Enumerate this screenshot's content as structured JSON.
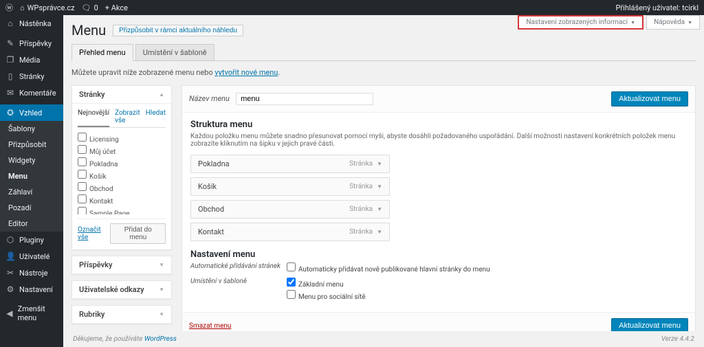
{
  "adminbar": {
    "site_name": "WPsprávce.cz",
    "comments": "0",
    "new": "+ Akce",
    "greeting": "Přihlášený uživatel: tcirkl"
  },
  "topactions": {
    "screen_options": "Nastavení zobrazených informací",
    "help": "Nápověda"
  },
  "sidemenu": {
    "dashboard": "Nástěnka",
    "posts": "Příspěvky",
    "media": "Média",
    "pages": "Stránky",
    "comments": "Komentáře",
    "appearance": "Vzhled",
    "appearance_sub": [
      "Šablony",
      "Přizpůsobit",
      "Widgety",
      "Menu",
      "Záhlaví",
      "Pozadí",
      "Editor"
    ],
    "plugins": "Pluginy",
    "users": "Uživatelé",
    "tools": "Nástroje",
    "settings": "Nastavení",
    "collapse": "Zmenšit menu"
  },
  "page": {
    "title": "Menu",
    "customize": "Přizpůsobit v rámci aktuálního náhledu",
    "tab_manage": "Přehled menu",
    "tab_locations": "Umístění v šabloně",
    "info_1": "Můžete upravit níže zobrazené menu nebo ",
    "info_link": "vytvořit nové menu",
    "info_2": "."
  },
  "metabox_pages": {
    "title": "Stránky",
    "tab_recent": "Nejnovější",
    "tab_all": "Zobrazit vše",
    "tab_search": "Hledat",
    "items": [
      "Licensing",
      "Můj účet",
      "Pokladna",
      "Košík",
      "Obchod",
      "Kontakt",
      "Sample Page"
    ],
    "select_all": "Označit vše",
    "add": "Přidat do menu"
  },
  "metabox_posts": {
    "title": "Příspěvky"
  },
  "metabox_links": {
    "title": "Uživatelské odkazy"
  },
  "metabox_cats": {
    "title": "Rubriky"
  },
  "menu": {
    "name_label": "Název menu",
    "name_value": "menu",
    "save": "Aktualizovat menu",
    "structure_title": "Struktura menu",
    "structure_help": "Každou položku menu můžete snadno přesunovat pomocí myši, abyste dosáhli požadovaného uspořádání. Další možnosti nastavení konkrétních položek menu zobrazíte kliknutím na šipku v jejich pravé části.",
    "items": [
      {
        "label": "Pokladna",
        "type": "Stránka"
      },
      {
        "label": "Košík",
        "type": "Stránka"
      },
      {
        "label": "Obchod",
        "type": "Stránka"
      },
      {
        "label": "Kontakt",
        "type": "Stránka"
      }
    ],
    "settings_title": "Nastavení menu",
    "auto_add_label": "Automatické přidávání stránek",
    "auto_add_option": "Automaticky přidávat nově publikované hlavní stránky do menu",
    "location_label": "Umístění v šabloně",
    "locations": [
      {
        "label": "Základní menu",
        "checked": true
      },
      {
        "label": "Menu pro sociální sítě",
        "checked": false
      }
    ],
    "delete": "Smazat menu"
  },
  "footer": {
    "thanks_1": "Děkujeme, že používáte ",
    "thanks_link": "WordPress",
    "version": "Verze 4.4.2"
  }
}
